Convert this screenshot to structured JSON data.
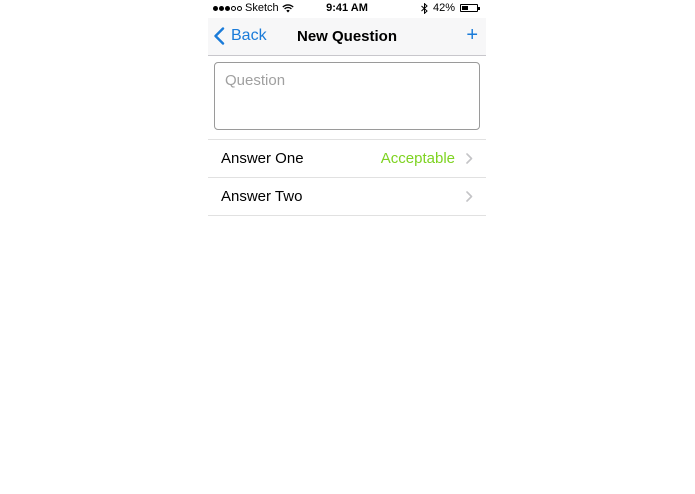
{
  "status_bar": {
    "carrier": "Sketch",
    "time": "9:41 AM",
    "battery_percent": "42%",
    "battery_level": 0.42,
    "signal_dots_filled": 3,
    "signal_dots_total": 5
  },
  "nav": {
    "back_label": "Back",
    "title": "New Question",
    "add_label": "+"
  },
  "question": {
    "placeholder": "Question",
    "value": ""
  },
  "answers": [
    {
      "label": "Answer One",
      "value": "Acceptable"
    },
    {
      "label": "Answer Two",
      "value": ""
    }
  ],
  "colors": {
    "tint": "#1a7bd9",
    "acceptable": "#7ed321"
  }
}
